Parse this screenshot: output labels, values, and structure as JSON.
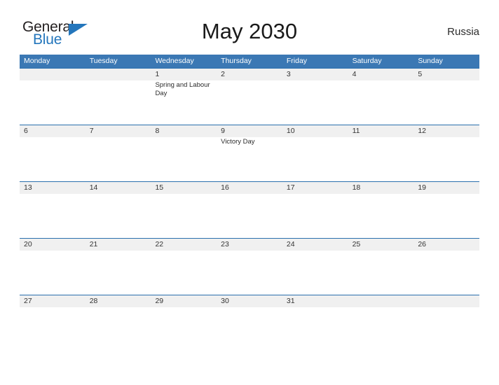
{
  "brand": {
    "name_part1": "General",
    "name_part2": "Blue",
    "color_dark": "#231f20",
    "color_blue": "#2476bc"
  },
  "header": {
    "title": "May 2030",
    "country": "Russia"
  },
  "theme": {
    "header_blue": "#3b78b4",
    "divider_blue": "#2a6fad",
    "band_gray": "#f0f0f0",
    "text_dark": "#333333",
    "page_background": "#ffffff"
  },
  "calendar": {
    "month": "May",
    "year": "2030",
    "week_start": "Monday",
    "weekdays": [
      "Monday",
      "Tuesday",
      "Wednesday",
      "Thursday",
      "Friday",
      "Saturday",
      "Sunday"
    ],
    "weeks": [
      [
        {
          "day": "",
          "event": ""
        },
        {
          "day": "",
          "event": ""
        },
        {
          "day": "1",
          "event": "Spring and Labour Day"
        },
        {
          "day": "2",
          "event": ""
        },
        {
          "day": "3",
          "event": ""
        },
        {
          "day": "4",
          "event": ""
        },
        {
          "day": "5",
          "event": ""
        }
      ],
      [
        {
          "day": "6",
          "event": ""
        },
        {
          "day": "7",
          "event": ""
        },
        {
          "day": "8",
          "event": ""
        },
        {
          "day": "9",
          "event": "Victory Day"
        },
        {
          "day": "10",
          "event": ""
        },
        {
          "day": "11",
          "event": ""
        },
        {
          "day": "12",
          "event": ""
        }
      ],
      [
        {
          "day": "13",
          "event": ""
        },
        {
          "day": "14",
          "event": ""
        },
        {
          "day": "15",
          "event": ""
        },
        {
          "day": "16",
          "event": ""
        },
        {
          "day": "17",
          "event": ""
        },
        {
          "day": "18",
          "event": ""
        },
        {
          "day": "19",
          "event": ""
        }
      ],
      [
        {
          "day": "20",
          "event": ""
        },
        {
          "day": "21",
          "event": ""
        },
        {
          "day": "22",
          "event": ""
        },
        {
          "day": "23",
          "event": ""
        },
        {
          "day": "24",
          "event": ""
        },
        {
          "day": "25",
          "event": ""
        },
        {
          "day": "26",
          "event": ""
        }
      ],
      [
        {
          "day": "27",
          "event": ""
        },
        {
          "day": "28",
          "event": ""
        },
        {
          "day": "29",
          "event": ""
        },
        {
          "day": "30",
          "event": ""
        },
        {
          "day": "31",
          "event": ""
        },
        {
          "day": "",
          "event": ""
        },
        {
          "day": "",
          "event": ""
        }
      ]
    ],
    "holidays": [
      {
        "date": "1",
        "name": "Spring and Labour Day"
      },
      {
        "date": "9",
        "name": "Victory Day"
      }
    ]
  }
}
